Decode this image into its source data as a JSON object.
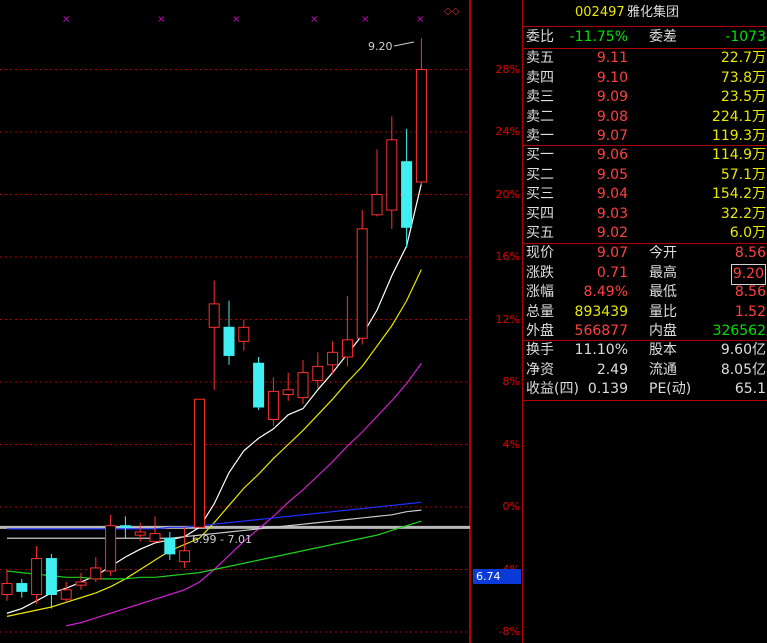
{
  "header": {
    "code": "002497",
    "name": "雅化集团"
  },
  "axis": {
    "ticks": [
      "28%",
      "24%",
      "20%",
      "16%",
      "12%",
      "8%",
      "4%",
      "0%",
      "-4%",
      "-8%"
    ],
    "current_price": "6.74"
  },
  "chart_annotations": {
    "high_label": "9.20",
    "range_label": "6.99 - 7.01"
  },
  "quote": {
    "weibi": {
      "label": "委比",
      "value": "-11.75%",
      "label2": "委差",
      "value2": "-1073"
    },
    "asks": [
      {
        "label": "卖五",
        "price": "9.11",
        "vol": "22.7万"
      },
      {
        "label": "卖四",
        "price": "9.10",
        "vol": "73.8万"
      },
      {
        "label": "卖三",
        "price": "9.09",
        "vol": "23.5万"
      },
      {
        "label": "卖二",
        "price": "9.08",
        "vol": "224.1万"
      },
      {
        "label": "卖一",
        "price": "9.07",
        "vol": "119.3万"
      }
    ],
    "bids": [
      {
        "label": "买一",
        "price": "9.06",
        "vol": "114.9万"
      },
      {
        "label": "买二",
        "price": "9.05",
        "vol": "57.1万"
      },
      {
        "label": "买三",
        "price": "9.04",
        "vol": "154.2万"
      },
      {
        "label": "买四",
        "price": "9.03",
        "vol": "32.2万"
      },
      {
        "label": "买五",
        "price": "9.02",
        "vol": "6.0万"
      }
    ],
    "stats": [
      {
        "l1": "现价",
        "v1": "9.07",
        "l2": "今开",
        "v2": "8.56"
      },
      {
        "l1": "涨跌",
        "v1": "0.71",
        "l2": "最高",
        "v2": "9.20"
      },
      {
        "l1": "涨幅",
        "v1": "8.49%",
        "l2": "最低",
        "v2": "8.56"
      },
      {
        "l1": "总量",
        "v1": "893439",
        "l2": "量比",
        "v2": "1.52"
      },
      {
        "l1": "外盘",
        "v1": "566877",
        "l2": "内盘",
        "v2": "326562"
      }
    ],
    "finance": [
      {
        "l1": "换手",
        "v1": "11.10%",
        "l2": "股本",
        "v2": "9.60亿"
      },
      {
        "l1": "净资",
        "v1": "2.49",
        "l2": "流通",
        "v2": "8.05亿"
      },
      {
        "l1": "收益(四)",
        "v1": "0.139",
        "l2": "PE(动)",
        "v2": "65.1"
      }
    ]
  },
  "chart_data": {
    "type": "candlestick",
    "ylabel_unit": "%",
    "ylim": [
      -8,
      30
    ],
    "candles": [
      {
        "o": -5.6,
        "c": -4.9,
        "h": -4.0,
        "l": -6.0
      },
      {
        "o": -4.9,
        "c": -5.4,
        "h": -4.6,
        "l": -5.8
      },
      {
        "o": -5.6,
        "c": -3.3,
        "h": -2.5,
        "l": -6.2
      },
      {
        "o": -3.3,
        "c": -5.6,
        "h": -3.0,
        "l": -6.5
      },
      {
        "o": -5.9,
        "c": -5.3,
        "h": -4.8,
        "l": -6.1
      },
      {
        "o": -5.0,
        "c": -4.8,
        "h": -4.2,
        "l": -5.3
      },
      {
        "o": -4.6,
        "c": -3.9,
        "h": -3.2,
        "l": -4.8
      },
      {
        "o": -4.1,
        "c": -1.2,
        "h": -0.5,
        "l": -4.4
      },
      {
        "o": -1.2,
        "c": -1.3,
        "h": -0.6,
        "l": -2.0
      },
      {
        "o": -1.8,
        "c": -1.6,
        "h": -1.0,
        "l": -2.2
      },
      {
        "o": -2.2,
        "c": -1.7,
        "h": -0.6,
        "l": -2.3
      },
      {
        "o": -2.0,
        "c": -3.0,
        "h": -1.6,
        "l": -3.4
      },
      {
        "o": -3.5,
        "c": -2.8,
        "h": -1.3,
        "l": -3.9
      },
      {
        "o": -1.3,
        "c": 6.9,
        "h": 6.9,
        "l": -1.3
      },
      {
        "o": 11.5,
        "c": 13.0,
        "h": 14.5,
        "l": 7.5
      },
      {
        "o": 11.5,
        "c": 9.7,
        "h": 13.2,
        "l": 9.1
      },
      {
        "o": 10.6,
        "c": 11.5,
        "h": 12.0,
        "l": 10.0
      },
      {
        "o": 9.2,
        "c": 6.4,
        "h": 9.6,
        "l": 6.2
      },
      {
        "o": 5.6,
        "c": 7.4,
        "h": 8.3,
        "l": 5.2
      },
      {
        "o": 7.2,
        "c": 7.5,
        "h": 8.6,
        "l": 6.8
      },
      {
        "o": 7.0,
        "c": 8.6,
        "h": 9.4,
        "l": 6.6
      },
      {
        "o": 8.1,
        "c": 9.0,
        "h": 9.9,
        "l": 7.6
      },
      {
        "o": 9.1,
        "c": 9.9,
        "h": 10.6,
        "l": 8.5
      },
      {
        "o": 9.6,
        "c": 10.7,
        "h": 13.5,
        "l": 9.0
      },
      {
        "o": 10.8,
        "c": 17.8,
        "h": 19.0,
        "l": 10.4
      },
      {
        "o": 18.7,
        "c": 20.0,
        "h": 22.9,
        "l": 18.6
      },
      {
        "o": 19.0,
        "c": 23.5,
        "h": 25.0,
        "l": 17.8
      },
      {
        "o": 22.1,
        "c": 17.9,
        "h": 24.2,
        "l": 16.6
      },
      {
        "o": 20.8,
        "c": 28.0,
        "h": 30.0,
        "l": 20.6
      }
    ],
    "ma_lines": [
      {
        "color": "#ffffff",
        "values": [
          -6.8,
          -6.5,
          -6.0,
          -5.5,
          -5.2,
          -4.8,
          -4.4,
          -3.8,
          -3.2,
          -2.7,
          -2.3,
          -2.1,
          -1.9,
          -1.3,
          0.2,
          2.2,
          3.6,
          4.4,
          5.0,
          5.9,
          6.3,
          7.5,
          8.6,
          9.8,
          11.0,
          12.6,
          14.8,
          16.7,
          20.7
        ]
      },
      {
        "color": "#e8e800",
        "values": [
          -7.0,
          -6.8,
          -6.6,
          -6.4,
          -6.1,
          -5.8,
          -5.5,
          -5.1,
          -4.6,
          -4.0,
          -3.4,
          -2.8,
          -2.4,
          -2.0,
          -1.0,
          0.1,
          1.2,
          2.1,
          3.1,
          4.0,
          4.9,
          5.9,
          6.9,
          8.0,
          9.0,
          10.3,
          11.6,
          13.2,
          15.2
        ]
      },
      {
        "color": "#d020d0",
        "values": [
          null,
          null,
          null,
          null,
          -7.6,
          -7.4,
          -7.1,
          -6.8,
          -6.5,
          -6.2,
          -5.9,
          -5.6,
          -5.3,
          -4.8,
          -4.0,
          -3.1,
          -2.2,
          -1.4,
          -0.6,
          0.3,
          1.1,
          2.0,
          2.9,
          3.9,
          4.8,
          5.8,
          6.8,
          7.9,
          9.2
        ]
      },
      {
        "color": "#20d020",
        "values": [
          -4.1,
          -4.2,
          -4.3,
          -4.4,
          -4.5,
          -4.5,
          -4.6,
          -4.6,
          -4.6,
          -4.5,
          -4.5,
          -4.4,
          -4.3,
          -4.2,
          -4.0,
          -3.8,
          -3.6,
          -3.4,
          -3.2,
          -3.0,
          -2.8,
          -2.6,
          -2.4,
          -2.2,
          -2.0,
          -1.8,
          -1.5,
          -1.2,
          -0.9
        ]
      },
      {
        "color": "#2030ff",
        "values": [
          -1.4,
          -1.4,
          -1.4,
          -1.4,
          -1.4,
          -1.4,
          -1.4,
          -1.4,
          -1.4,
          -1.4,
          -1.4,
          -1.3,
          -1.3,
          -1.2,
          -1.1,
          -1.0,
          -0.9,
          -0.8,
          -0.7,
          -0.6,
          -0.5,
          -0.4,
          -0.3,
          -0.2,
          -0.1,
          0.0,
          0.1,
          0.2,
          0.3
        ]
      },
      {
        "color": "#c8c8c8",
        "values": [
          -2.0,
          -2.0,
          -2.0,
          -2.0,
          -2.0,
          -2.0,
          -2.0,
          -2.0,
          -2.0,
          -2.0,
          -2.0,
          -2.0,
          -1.9,
          -1.8,
          -1.7,
          -1.6,
          -1.5,
          -1.4,
          -1.3,
          -1.2,
          -1.1,
          -1.0,
          -0.9,
          -0.8,
          -0.7,
          -0.6,
          -0.5,
          -0.3,
          -0.2
        ]
      }
    ],
    "reference_level": -1.3,
    "colors": {
      "up": "#ff3030",
      "down": "#40f0f0",
      "grid": "#b00000",
      "text": "#e00000"
    }
  }
}
